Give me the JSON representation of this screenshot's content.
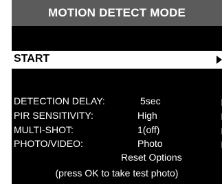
{
  "title": "MOTION DETECT MODE",
  "start": {
    "label": "START",
    "arrow_icon": "triangle-right-icon"
  },
  "settings": [
    {
      "label": "DETECTION DELAY:",
      "value": "5sec"
    },
    {
      "label": "PIR SENSITIVITY:",
      "value": "High"
    },
    {
      "label": "MULTI-SHOT:",
      "value": "1(off)"
    },
    {
      "label": "PHOTO/VIDEO:",
      "value": "Photo"
    }
  ],
  "reset_options": "Reset Options",
  "footer_note": "(press OK to take test photo)",
  "colors": {
    "background": "#000000",
    "title_bar": "#5b5b5b",
    "highlight": "#ffffff",
    "text": "#ffffff"
  }
}
